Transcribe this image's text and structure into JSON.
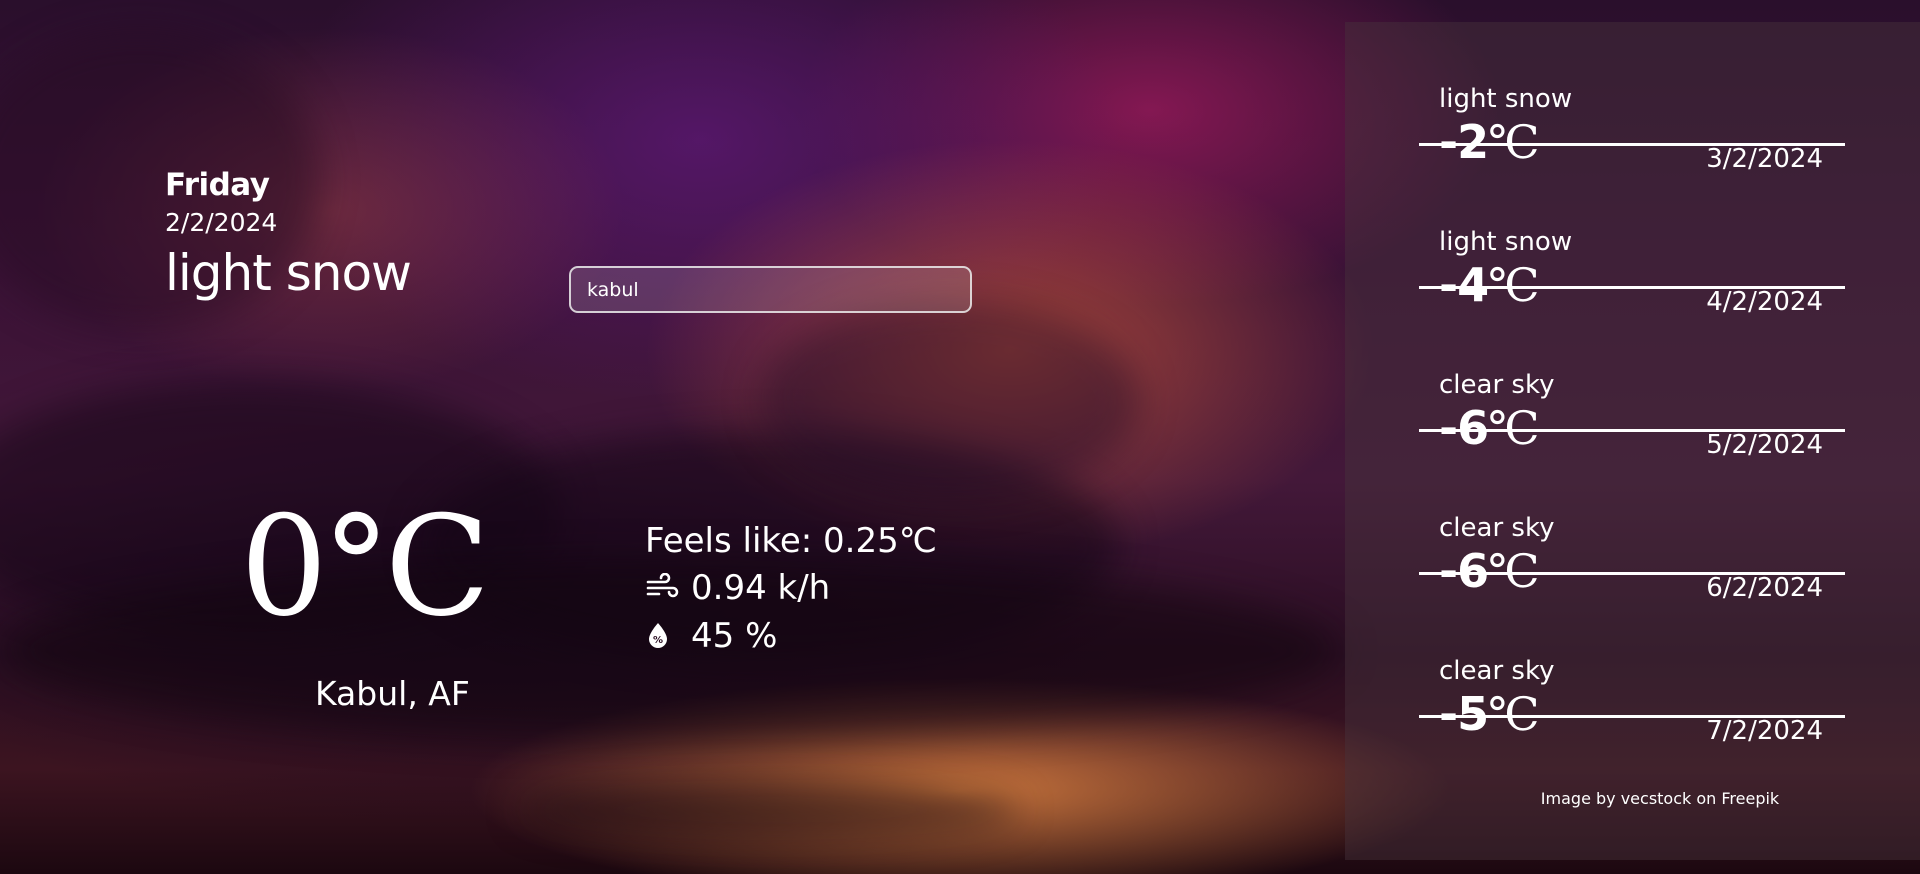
{
  "current": {
    "day": "Friday",
    "date": "2/2/2024",
    "condition": "light snow",
    "temperature": "0°C",
    "location": "Kabul, AF",
    "feels_like": "Feels like: 0.25℃",
    "wind": "0.94 k/h",
    "humidity": "45 %"
  },
  "search": {
    "value": "kabul",
    "placeholder": ""
  },
  "forecast": [
    {
      "description": "light snow",
      "temp": "-2",
      "unit": "℃",
      "date": "3/2/2024"
    },
    {
      "description": "light snow",
      "temp": "-4",
      "unit": "℃",
      "date": "4/2/2024"
    },
    {
      "description": "clear sky",
      "temp": "-6",
      "unit": "℃",
      "date": "5/2/2024"
    },
    {
      "description": "clear sky",
      "temp": "-6",
      "unit": "℃",
      "date": "6/2/2024"
    },
    {
      "description": "clear sky",
      "temp": "-5",
      "unit": "℃",
      "date": "7/2/2024"
    }
  ],
  "credit": "Image by vecstock on Freepik",
  "icons": {
    "wind": "wind-icon",
    "humidity": "humidity-drop-icon"
  },
  "colors": {
    "text": "#ffffff",
    "panel": "#463238",
    "divider": "#ffffff"
  }
}
